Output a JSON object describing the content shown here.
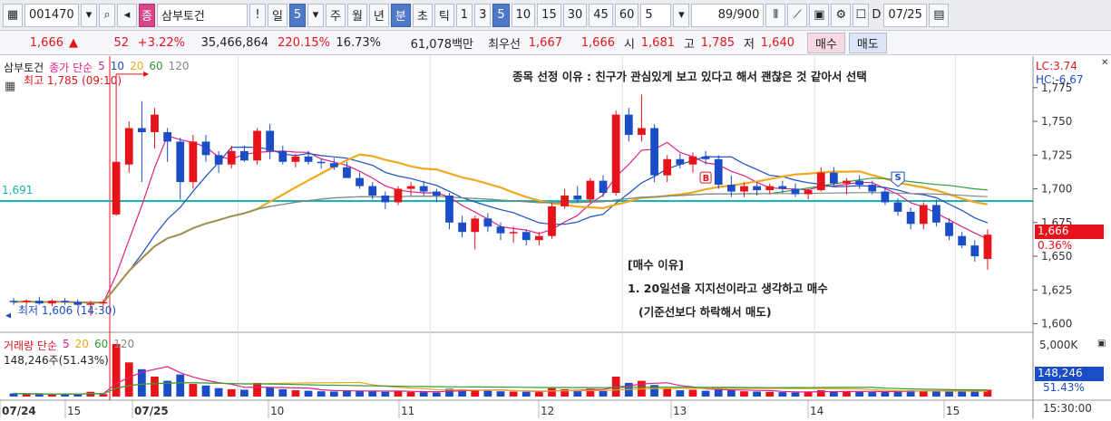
{
  "toolbar": {
    "code": "001470",
    "name": "삼부토건",
    "name_badge": "종",
    "excl": "!",
    "period_day": "일",
    "period_num": "5",
    "tabs": [
      "주",
      "월",
      "년",
      "분",
      "초",
      "틱"
    ],
    "minute_options": [
      "1",
      "3",
      "5",
      "10",
      "15",
      "30",
      "45",
      "60"
    ],
    "selected_minute": "5",
    "count_value": "5",
    "zoom_display": "89/900",
    "date_check": "D",
    "date_value": "07/25"
  },
  "quote": {
    "price": "1,666",
    "change_arrow": "▲",
    "change": "52",
    "change_pct": "+3.22%",
    "volume": "35,466,864",
    "volume_ratio": "220.15%",
    "turnover": "16.73%",
    "amount": "61,078백만",
    "best_ask_label": "최우선",
    "best_ask": "1,667",
    "best_bid": "1,666",
    "open_label": "시",
    "open": "1,681",
    "high_label": "고",
    "high": "1,785",
    "low_label": "저",
    "low": "1,640",
    "buy_button": "매수",
    "sell_button": "매도"
  },
  "legend": {
    "stock": "삼부토건",
    "price_ma_label": "종가 단순",
    "ma_periods": [
      "5",
      "10",
      "20",
      "60",
      "120"
    ],
    "ma_colors": [
      "#e0218a",
      "#1a4dc6",
      "#f0a81e",
      "#2e9b3a",
      "#888888"
    ],
    "volume_label": "거래량 단순",
    "volume_ma": [
      "5",
      "20",
      "60",
      "120"
    ],
    "volume_value": "148,246주(51.43%)"
  },
  "annotations": {
    "reason_title": "종목 선정 이유 : 친구가 관심있게 보고 있다고 해서 괜찮은 것 같아서 선택",
    "buy_reason_header": "[매수 이유]",
    "buy_reason_1": "1. 20일선을 지지선이라고 생각하고 매수",
    "buy_reason_2": "(기준선보다 하락해서 매도)",
    "high_marker": "최고 1,785 (09:10)",
    "low_marker": "최저 1,606 (14:30)",
    "hline_value": "1,691",
    "buy_marker": "B",
    "sell_marker": "S"
  },
  "right_axis": {
    "lc": "LC:3.74",
    "hc": "HC:-6.67",
    "price_ticks": [
      "1,775",
      "1,750",
      "1,725",
      "1,700",
      "1,675",
      "1,650",
      "1,625",
      "1,600"
    ],
    "current_price": "1,666",
    "current_pct": "0.36%",
    "volume_tick": "5,000K",
    "volume_current": "148,246",
    "volume_pct": "51.43%",
    "time_label": "15:30:00"
  },
  "x_axis": {
    "labels": [
      "07/24",
      "15",
      "07/25",
      "10",
      "11",
      "12",
      "13",
      "14",
      "15"
    ]
  },
  "chart_data": {
    "type": "candlestick",
    "interval": "5분",
    "ylim": [
      1597,
      1793
    ],
    "horizontal_line": 1691,
    "candles": [
      {
        "o": 1617,
        "h": 1619,
        "l": 1614,
        "c": 1616
      },
      {
        "o": 1616,
        "h": 1618,
        "l": 1614,
        "c": 1617
      },
      {
        "o": 1617,
        "h": 1620,
        "l": 1614,
        "c": 1615
      },
      {
        "o": 1615,
        "h": 1618,
        "l": 1613,
        "c": 1617
      },
      {
        "o": 1617,
        "h": 1619,
        "l": 1614,
        "c": 1616
      },
      {
        "o": 1616,
        "h": 1618,
        "l": 1613,
        "c": 1614
      },
      {
        "o": 1614,
        "h": 1617,
        "l": 1606,
        "c": 1615
      },
      {
        "o": 1615,
        "h": 1618,
        "l": 1613,
        "c": 1616
      },
      {
        "o": 1681,
        "h": 1785,
        "l": 1680,
        "c": 1720
      },
      {
        "o": 1718,
        "h": 1750,
        "l": 1712,
        "c": 1745
      },
      {
        "o": 1745,
        "h": 1765,
        "l": 1705,
        "c": 1742
      },
      {
        "o": 1742,
        "h": 1760,
        "l": 1730,
        "c": 1755
      },
      {
        "o": 1742,
        "h": 1745,
        "l": 1720,
        "c": 1735
      },
      {
        "o": 1735,
        "h": 1738,
        "l": 1692,
        "c": 1705
      },
      {
        "o": 1705,
        "h": 1740,
        "l": 1700,
        "c": 1735
      },
      {
        "o": 1735,
        "h": 1740,
        "l": 1720,
        "c": 1725
      },
      {
        "o": 1725,
        "h": 1728,
        "l": 1712,
        "c": 1718
      },
      {
        "o": 1718,
        "h": 1732,
        "l": 1715,
        "c": 1728
      },
      {
        "o": 1728,
        "h": 1732,
        "l": 1720,
        "c": 1721
      },
      {
        "o": 1721,
        "h": 1745,
        "l": 1718,
        "c": 1743
      },
      {
        "o": 1743,
        "h": 1748,
        "l": 1722,
        "c": 1728
      },
      {
        "o": 1728,
        "h": 1732,
        "l": 1718,
        "c": 1720
      },
      {
        "o": 1720,
        "h": 1726,
        "l": 1716,
        "c": 1724
      },
      {
        "o": 1724,
        "h": 1728,
        "l": 1718,
        "c": 1720
      },
      {
        "o": 1720,
        "h": 1722,
        "l": 1715,
        "c": 1719
      },
      {
        "o": 1719,
        "h": 1723,
        "l": 1714,
        "c": 1716
      },
      {
        "o": 1716,
        "h": 1720,
        "l": 1710,
        "c": 1708
      },
      {
        "o": 1708,
        "h": 1712,
        "l": 1700,
        "c": 1702
      },
      {
        "o": 1702,
        "h": 1705,
        "l": 1692,
        "c": 1695
      },
      {
        "o": 1695,
        "h": 1698,
        "l": 1685,
        "c": 1690
      },
      {
        "o": 1690,
        "h": 1702,
        "l": 1688,
        "c": 1700
      },
      {
        "o": 1700,
        "h": 1705,
        "l": 1695,
        "c": 1702
      },
      {
        "o": 1702,
        "h": 1706,
        "l": 1695,
        "c": 1698
      },
      {
        "o": 1698,
        "h": 1700,
        "l": 1690,
        "c": 1695
      },
      {
        "o": 1695,
        "h": 1697,
        "l": 1670,
        "c": 1675
      },
      {
        "o": 1675,
        "h": 1680,
        "l": 1664,
        "c": 1668
      },
      {
        "o": 1668,
        "h": 1680,
        "l": 1655,
        "c": 1678
      },
      {
        "o": 1678,
        "h": 1682,
        "l": 1668,
        "c": 1672
      },
      {
        "o": 1672,
        "h": 1675,
        "l": 1662,
        "c": 1667
      },
      {
        "o": 1667,
        "h": 1672,
        "l": 1660,
        "c": 1668
      },
      {
        "o": 1668,
        "h": 1670,
        "l": 1658,
        "c": 1662
      },
      {
        "o": 1662,
        "h": 1668,
        "l": 1658,
        "c": 1665
      },
      {
        "o": 1665,
        "h": 1690,
        "l": 1663,
        "c": 1687
      },
      {
        "o": 1687,
        "h": 1700,
        "l": 1685,
        "c": 1695
      },
      {
        "o": 1695,
        "h": 1702,
        "l": 1690,
        "c": 1692
      },
      {
        "o": 1692,
        "h": 1708,
        "l": 1690,
        "c": 1706
      },
      {
        "o": 1706,
        "h": 1710,
        "l": 1694,
        "c": 1697
      },
      {
        "o": 1697,
        "h": 1758,
        "l": 1695,
        "c": 1755
      },
      {
        "o": 1755,
        "h": 1760,
        "l": 1735,
        "c": 1740
      },
      {
        "o": 1740,
        "h": 1770,
        "l": 1735,
        "c": 1745
      },
      {
        "o": 1745,
        "h": 1748,
        "l": 1705,
        "c": 1710
      },
      {
        "o": 1710,
        "h": 1725,
        "l": 1705,
        "c": 1722
      },
      {
        "o": 1722,
        "h": 1726,
        "l": 1715,
        "c": 1718
      },
      {
        "o": 1718,
        "h": 1727,
        "l": 1712,
        "c": 1724
      },
      {
        "o": 1724,
        "h": 1728,
        "l": 1718,
        "c": 1722
      },
      {
        "o": 1722,
        "h": 1725,
        "l": 1700,
        "c": 1703
      },
      {
        "o": 1703,
        "h": 1710,
        "l": 1694,
        "c": 1698
      },
      {
        "o": 1698,
        "h": 1705,
        "l": 1694,
        "c": 1702
      },
      {
        "o": 1702,
        "h": 1705,
        "l": 1695,
        "c": 1699
      },
      {
        "o": 1699,
        "h": 1704,
        "l": 1696,
        "c": 1702
      },
      {
        "o": 1702,
        "h": 1706,
        "l": 1697,
        "c": 1700
      },
      {
        "o": 1700,
        "h": 1704,
        "l": 1694,
        "c": 1696
      },
      {
        "o": 1696,
        "h": 1700,
        "l": 1692,
        "c": 1699
      },
      {
        "o": 1699,
        "h": 1716,
        "l": 1698,
        "c": 1712
      },
      {
        "o": 1712,
        "h": 1716,
        "l": 1702,
        "c": 1704
      },
      {
        "o": 1704,
        "h": 1708,
        "l": 1696,
        "c": 1706
      },
      {
        "o": 1706,
        "h": 1710,
        "l": 1700,
        "c": 1703
      },
      {
        "o": 1703,
        "h": 1706,
        "l": 1696,
        "c": 1698
      },
      {
        "o": 1698,
        "h": 1700,
        "l": 1688,
        "c": 1690
      },
      {
        "o": 1690,
        "h": 1693,
        "l": 1680,
        "c": 1683
      },
      {
        "o": 1683,
        "h": 1686,
        "l": 1670,
        "c": 1674
      },
      {
        "o": 1674,
        "h": 1690,
        "l": 1670,
        "c": 1688
      },
      {
        "o": 1688,
        "h": 1692,
        "l": 1672,
        "c": 1675
      },
      {
        "o": 1675,
        "h": 1678,
        "l": 1662,
        "c": 1665
      },
      {
        "o": 1665,
        "h": 1668,
        "l": 1656,
        "c": 1658
      },
      {
        "o": 1658,
        "h": 1662,
        "l": 1646,
        "c": 1650
      },
      {
        "o": 1648,
        "h": 1670,
        "l": 1640,
        "c": 1666
      }
    ],
    "volumes": [
      60,
      45,
      50,
      40,
      55,
      42,
      90,
      48,
      1000,
      650,
      520,
      380,
      300,
      420,
      240,
      210,
      160,
      140,
      130,
      260,
      180,
      140,
      120,
      110,
      100,
      95,
      120,
      110,
      100,
      90,
      110,
      90,
      85,
      80,
      150,
      140,
      130,
      110,
      100,
      95,
      90,
      85,
      160,
      140,
      120,
      150,
      110,
      380,
      260,
      300,
      220,
      150,
      120,
      130,
      110,
      160,
      120,
      100,
      95,
      90,
      85,
      80,
      90,
      120,
      100,
      95,
      90,
      85,
      100,
      110,
      120,
      110,
      100,
      105,
      110,
      120,
      130
    ]
  }
}
